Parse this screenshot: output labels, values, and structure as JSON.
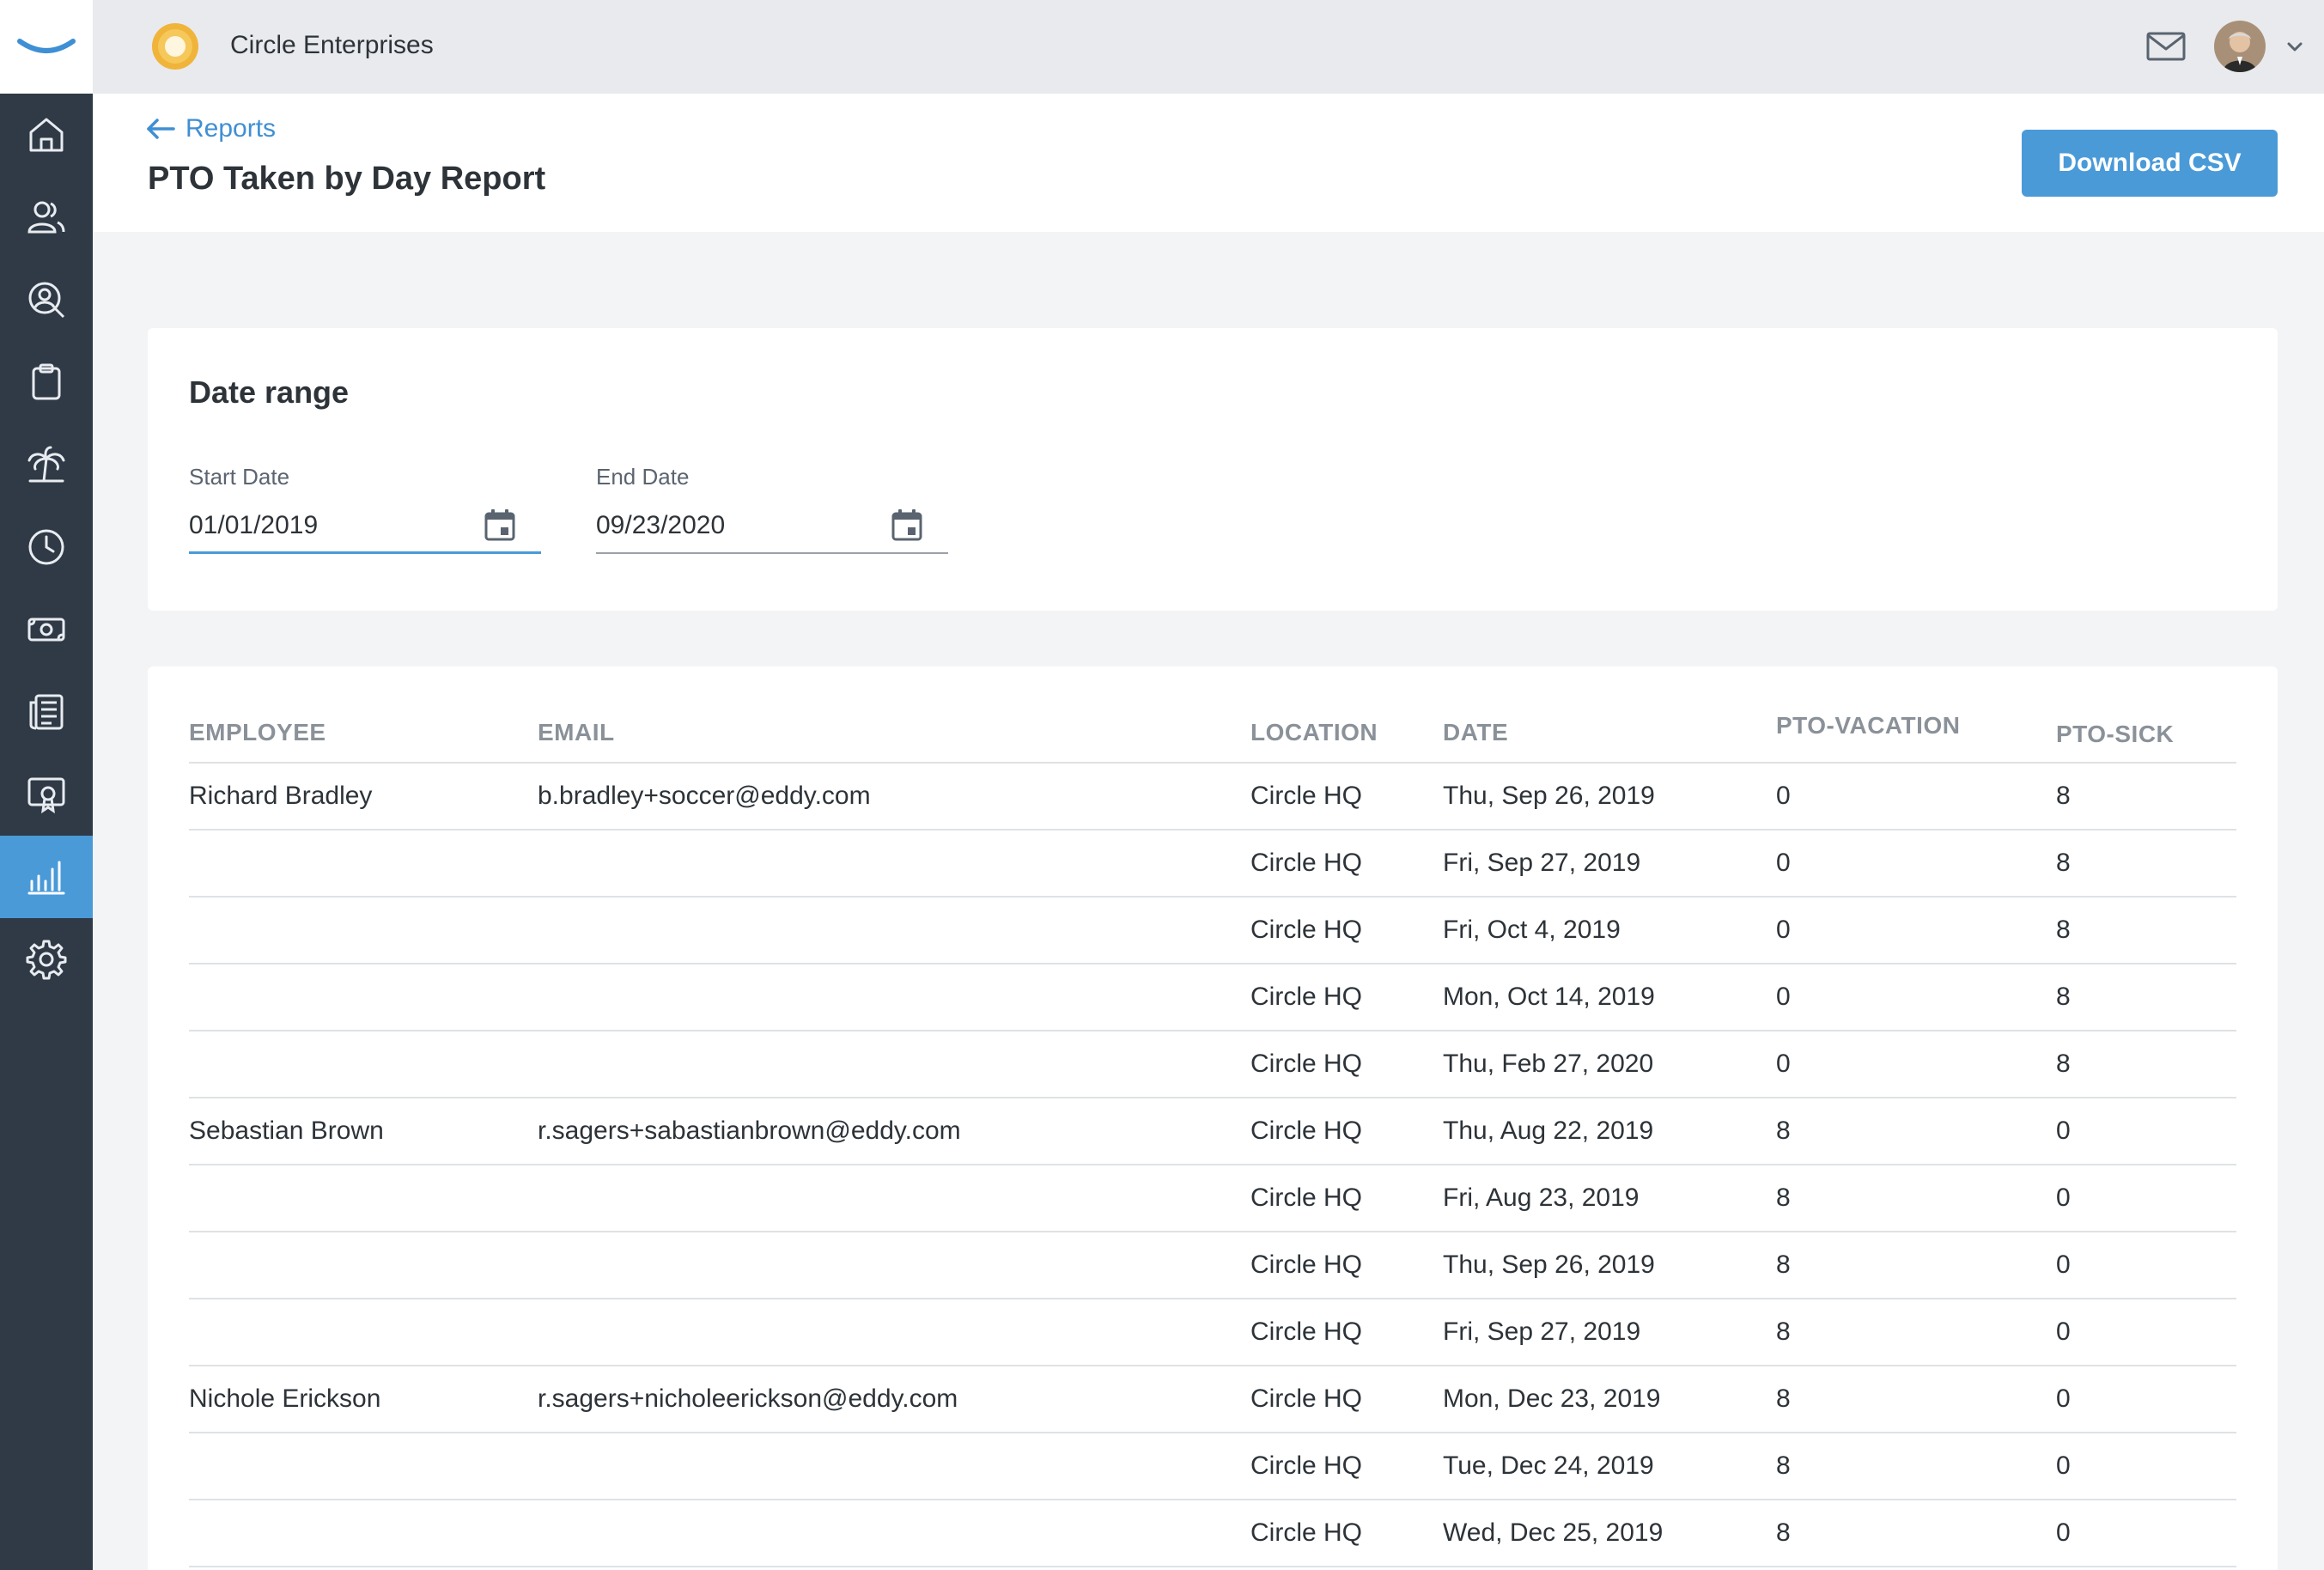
{
  "topbar": {
    "company_name": "Circle Enterprises"
  },
  "sidebar": {
    "items": [
      {
        "icon": "home-icon",
        "active": false
      },
      {
        "icon": "people-icon",
        "active": false
      },
      {
        "icon": "user-search-icon",
        "active": false
      },
      {
        "icon": "clipboard-icon",
        "active": false
      },
      {
        "icon": "palm-tree-icon",
        "active": false
      },
      {
        "icon": "clock-icon",
        "active": false
      },
      {
        "icon": "money-icon",
        "active": false
      },
      {
        "icon": "newspaper-icon",
        "active": false
      },
      {
        "icon": "certificate-icon",
        "active": false
      },
      {
        "icon": "bar-chart-icon",
        "active": true
      },
      {
        "icon": "gear-icon",
        "active": false
      }
    ]
  },
  "header": {
    "back_label": "Reports",
    "title": "PTO Taken by Day Report",
    "download_label": "Download CSV"
  },
  "date_range": {
    "title": "Date range",
    "start_label": "Start Date",
    "start_value": "01/01/2019",
    "end_label": "End Date",
    "end_value": "09/23/2020"
  },
  "table": {
    "columns": [
      "EMPLOYEE",
      "EMAIL",
      "LOCATION",
      "DATE",
      "PTO-VACATION",
      "PTO-SICK"
    ],
    "rows": [
      {
        "employee": "Richard Bradley",
        "email": "b.bradley+soccer@eddy.com",
        "location": "Circle HQ",
        "date": "Thu, Sep 26, 2019",
        "vacation": "0",
        "sick": "8"
      },
      {
        "employee": "",
        "email": "",
        "location": "Circle HQ",
        "date": "Fri, Sep 27, 2019",
        "vacation": "0",
        "sick": "8"
      },
      {
        "employee": "",
        "email": "",
        "location": "Circle HQ",
        "date": "Fri, Oct 4, 2019",
        "vacation": "0",
        "sick": "8"
      },
      {
        "employee": "",
        "email": "",
        "location": "Circle HQ",
        "date": "Mon, Oct 14, 2019",
        "vacation": "0",
        "sick": "8"
      },
      {
        "employee": "",
        "email": "",
        "location": "Circle HQ",
        "date": "Thu, Feb 27, 2020",
        "vacation": "0",
        "sick": "8"
      },
      {
        "employee": "Sebastian Brown",
        "email": "r.sagers+sabastianbrown@eddy.com",
        "location": "Circle HQ",
        "date": "Thu, Aug 22, 2019",
        "vacation": "8",
        "sick": "0"
      },
      {
        "employee": "",
        "email": "",
        "location": "Circle HQ",
        "date": "Fri, Aug 23, 2019",
        "vacation": "8",
        "sick": "0"
      },
      {
        "employee": "",
        "email": "",
        "location": "Circle HQ",
        "date": "Thu, Sep 26, 2019",
        "vacation": "8",
        "sick": "0"
      },
      {
        "employee": "",
        "email": "",
        "location": "Circle HQ",
        "date": "Fri, Sep 27, 2019",
        "vacation": "8",
        "sick": "0"
      },
      {
        "employee": "Nichole Erickson",
        "email": "r.sagers+nicholeerickson@eddy.com",
        "location": "Circle HQ",
        "date": "Mon, Dec 23, 2019",
        "vacation": "8",
        "sick": "0"
      },
      {
        "employee": "",
        "email": "",
        "location": "Circle HQ",
        "date": "Tue, Dec 24, 2019",
        "vacation": "8",
        "sick": "0"
      },
      {
        "employee": "",
        "email": "",
        "location": "Circle HQ",
        "date": "Wed, Dec 25, 2019",
        "vacation": "8",
        "sick": "0"
      }
    ]
  },
  "colors": {
    "accent": "#4a9ad8",
    "sidebar": "#2f3a46",
    "topbar": "#e8eaed",
    "page_bg": "#f3f4f6"
  }
}
